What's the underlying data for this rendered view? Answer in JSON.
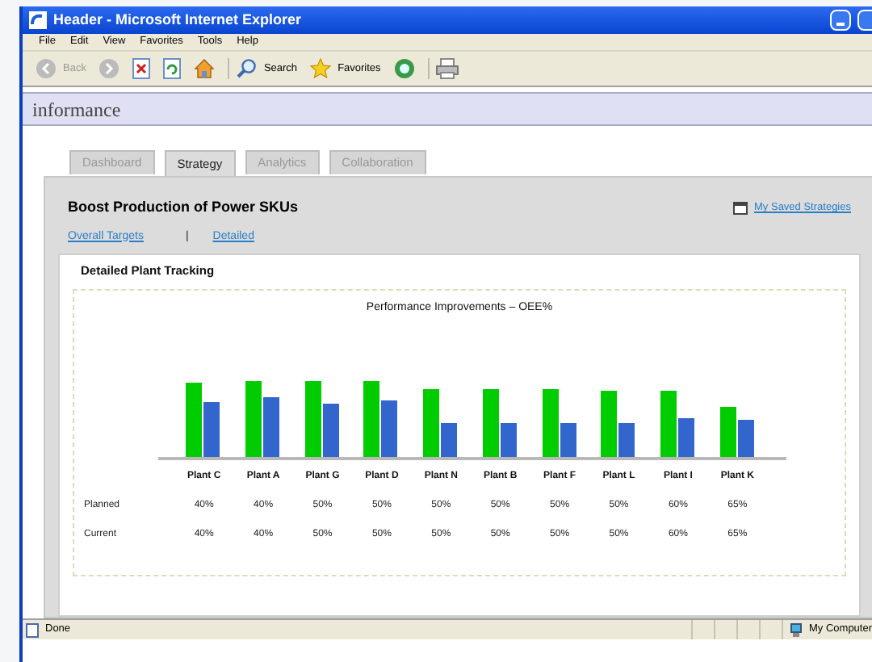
{
  "window": {
    "title": "Header - Microsoft Internet Explorer"
  },
  "menu": [
    "File",
    "Edit",
    "View",
    "Favorites",
    "Tools",
    "Help"
  ],
  "toolbar": {
    "back": "Back",
    "search": "Search",
    "favorites": "Favorites"
  },
  "logo": "informance",
  "tabs": [
    {
      "label": "Dashboard",
      "selected": false
    },
    {
      "label": "Strategy",
      "selected": true
    },
    {
      "label": "Analytics",
      "selected": false
    },
    {
      "label": "Collaboration",
      "selected": false
    }
  ],
  "page": {
    "title": "Boost Production of Power SKUs",
    "saved_link": "My Saved Strategies",
    "links": [
      "Overall Targets",
      "Detailed"
    ],
    "separator": "|"
  },
  "card": {
    "title": "Detailed Plant Tracking",
    "chart_title": "Performance Improvements – OEE%"
  },
  "table": {
    "columns": [
      "Plant C",
      "Plant A",
      "Plant G",
      "Plant D",
      "Plant N",
      "Plant B",
      "Plant F",
      "Plant L",
      "Plant I",
      "Plant K"
    ],
    "rows": [
      {
        "label": "Planned",
        "cells": [
          "40%",
          "40%",
          "50%",
          "50%",
          "50%",
          "50%",
          "50%",
          "50%",
          "60%",
          "65%"
        ]
      },
      {
        "label": "Current",
        "cells": [
          "40%",
          "40%",
          "50%",
          "50%",
          "50%",
          "50%",
          "50%",
          "50%",
          "60%",
          "65%"
        ]
      }
    ]
  },
  "status_bar": {
    "left": "Done",
    "right": "My Computer"
  }
}
